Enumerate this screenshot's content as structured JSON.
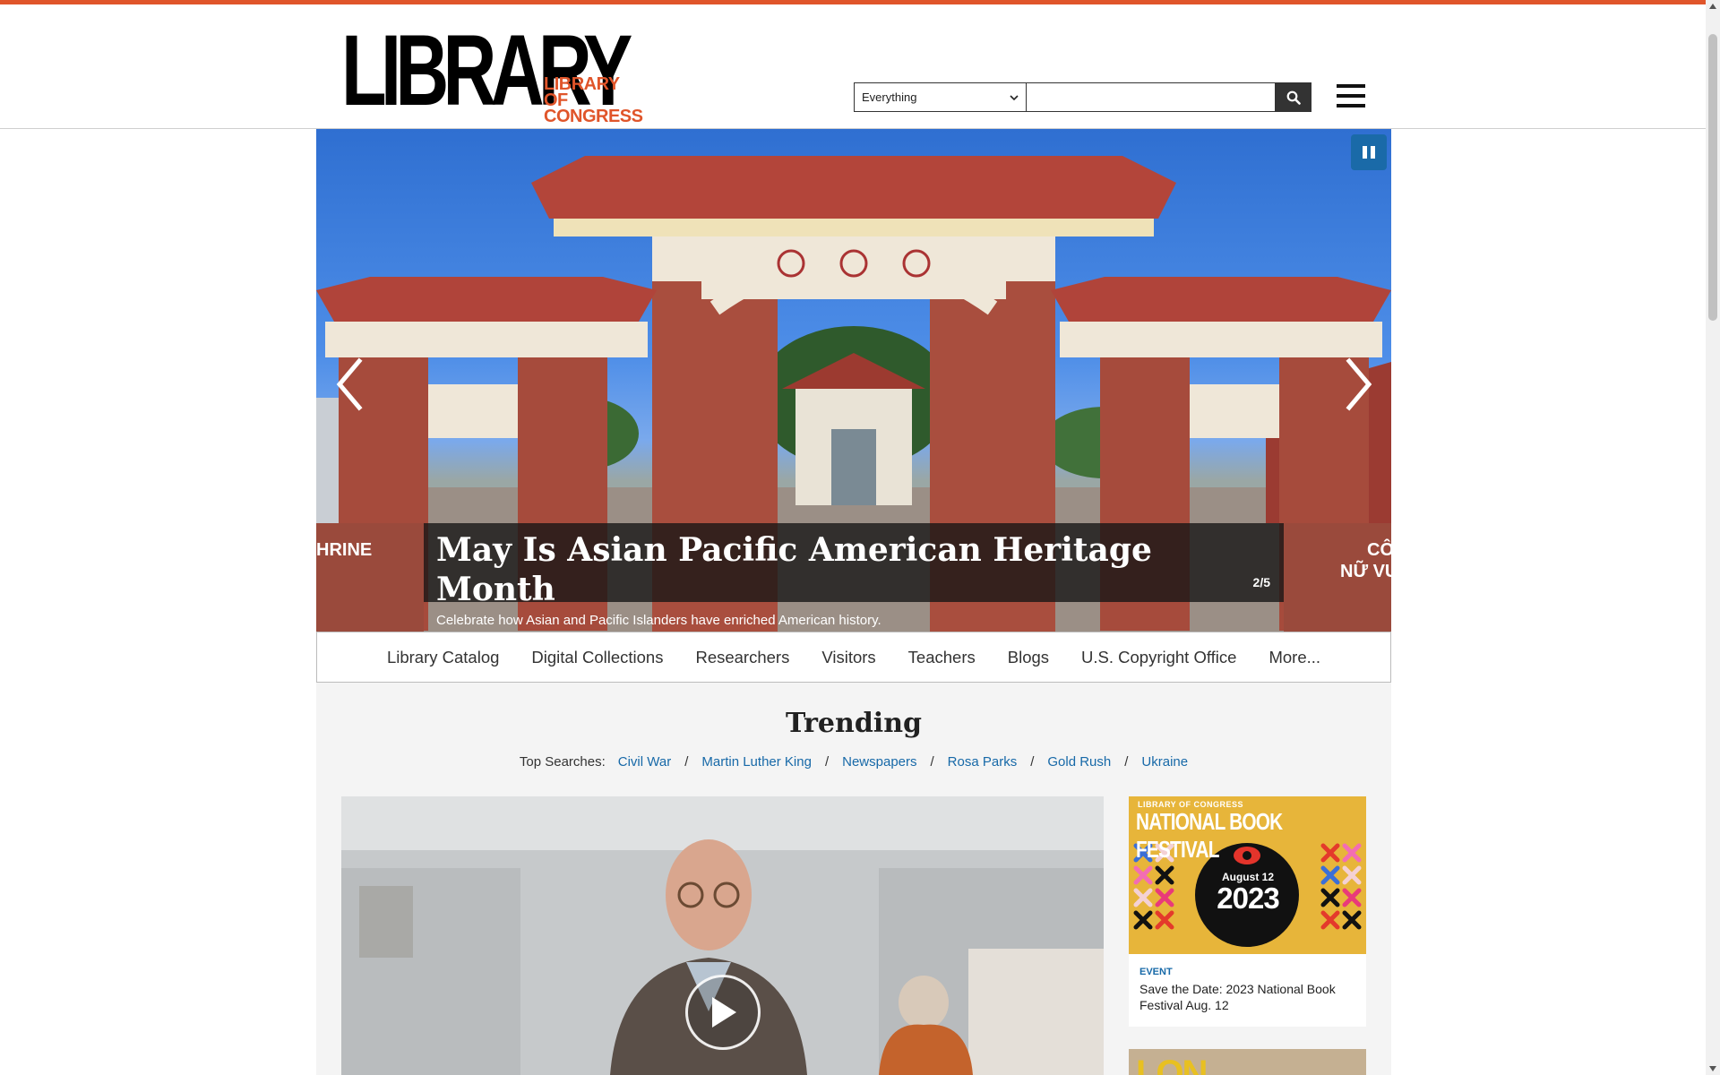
{
  "colors": {
    "brand_orange": "#e0552a",
    "link_blue": "#1769a8",
    "pause_blue": "#1a6aa8",
    "dark": "#333333"
  },
  "header": {
    "logo_word": "LIBRARY",
    "logo_sub_line1": "LIBRARY",
    "logo_sub_line2": "OF CONGRESS",
    "search": {
      "scope_value": "Everything",
      "input_value": "",
      "button_icon": "search-icon"
    },
    "menu_icon": "hamburger-icon"
  },
  "hero": {
    "title": "May Is Asian Pacific American Heritage Month",
    "subtitle": "Celebrate how Asian and Pacific Islanders have enriched American history.",
    "counter": "2/5",
    "sign_left": "HRINE",
    "sign_right_1": "CÔ",
    "sign_right_2": "NỮ VU",
    "controls": {
      "pause_icon": "pause-icon",
      "prev_icon": "chevron-left-icon",
      "next_icon": "chevron-right-icon"
    }
  },
  "subnav": {
    "items": [
      "Library Catalog",
      "Digital Collections",
      "Researchers",
      "Visitors",
      "Teachers",
      "Blogs",
      "U.S. Copyright Office",
      "More..."
    ]
  },
  "trending": {
    "title": "Trending",
    "top_searches_label": "Top Searches:",
    "searches": [
      "Civil War",
      "Martin Luther King",
      "Newspapers",
      "Rosa Parks",
      "Gold Rush",
      "Ukraine"
    ],
    "separator": "/"
  },
  "video": {
    "play_icon": "play-icon"
  },
  "event_card": {
    "img_top": "LIBRARY OF CONGRESS",
    "img_title": "NATIONAL BOOK FESTIVAL",
    "img_date": "August 12",
    "img_year": "2023",
    "kicker": "EVENT",
    "text": "Save the Date: 2023 National Book Festival Aug. 12"
  },
  "card2": {
    "text": "LON"
  }
}
